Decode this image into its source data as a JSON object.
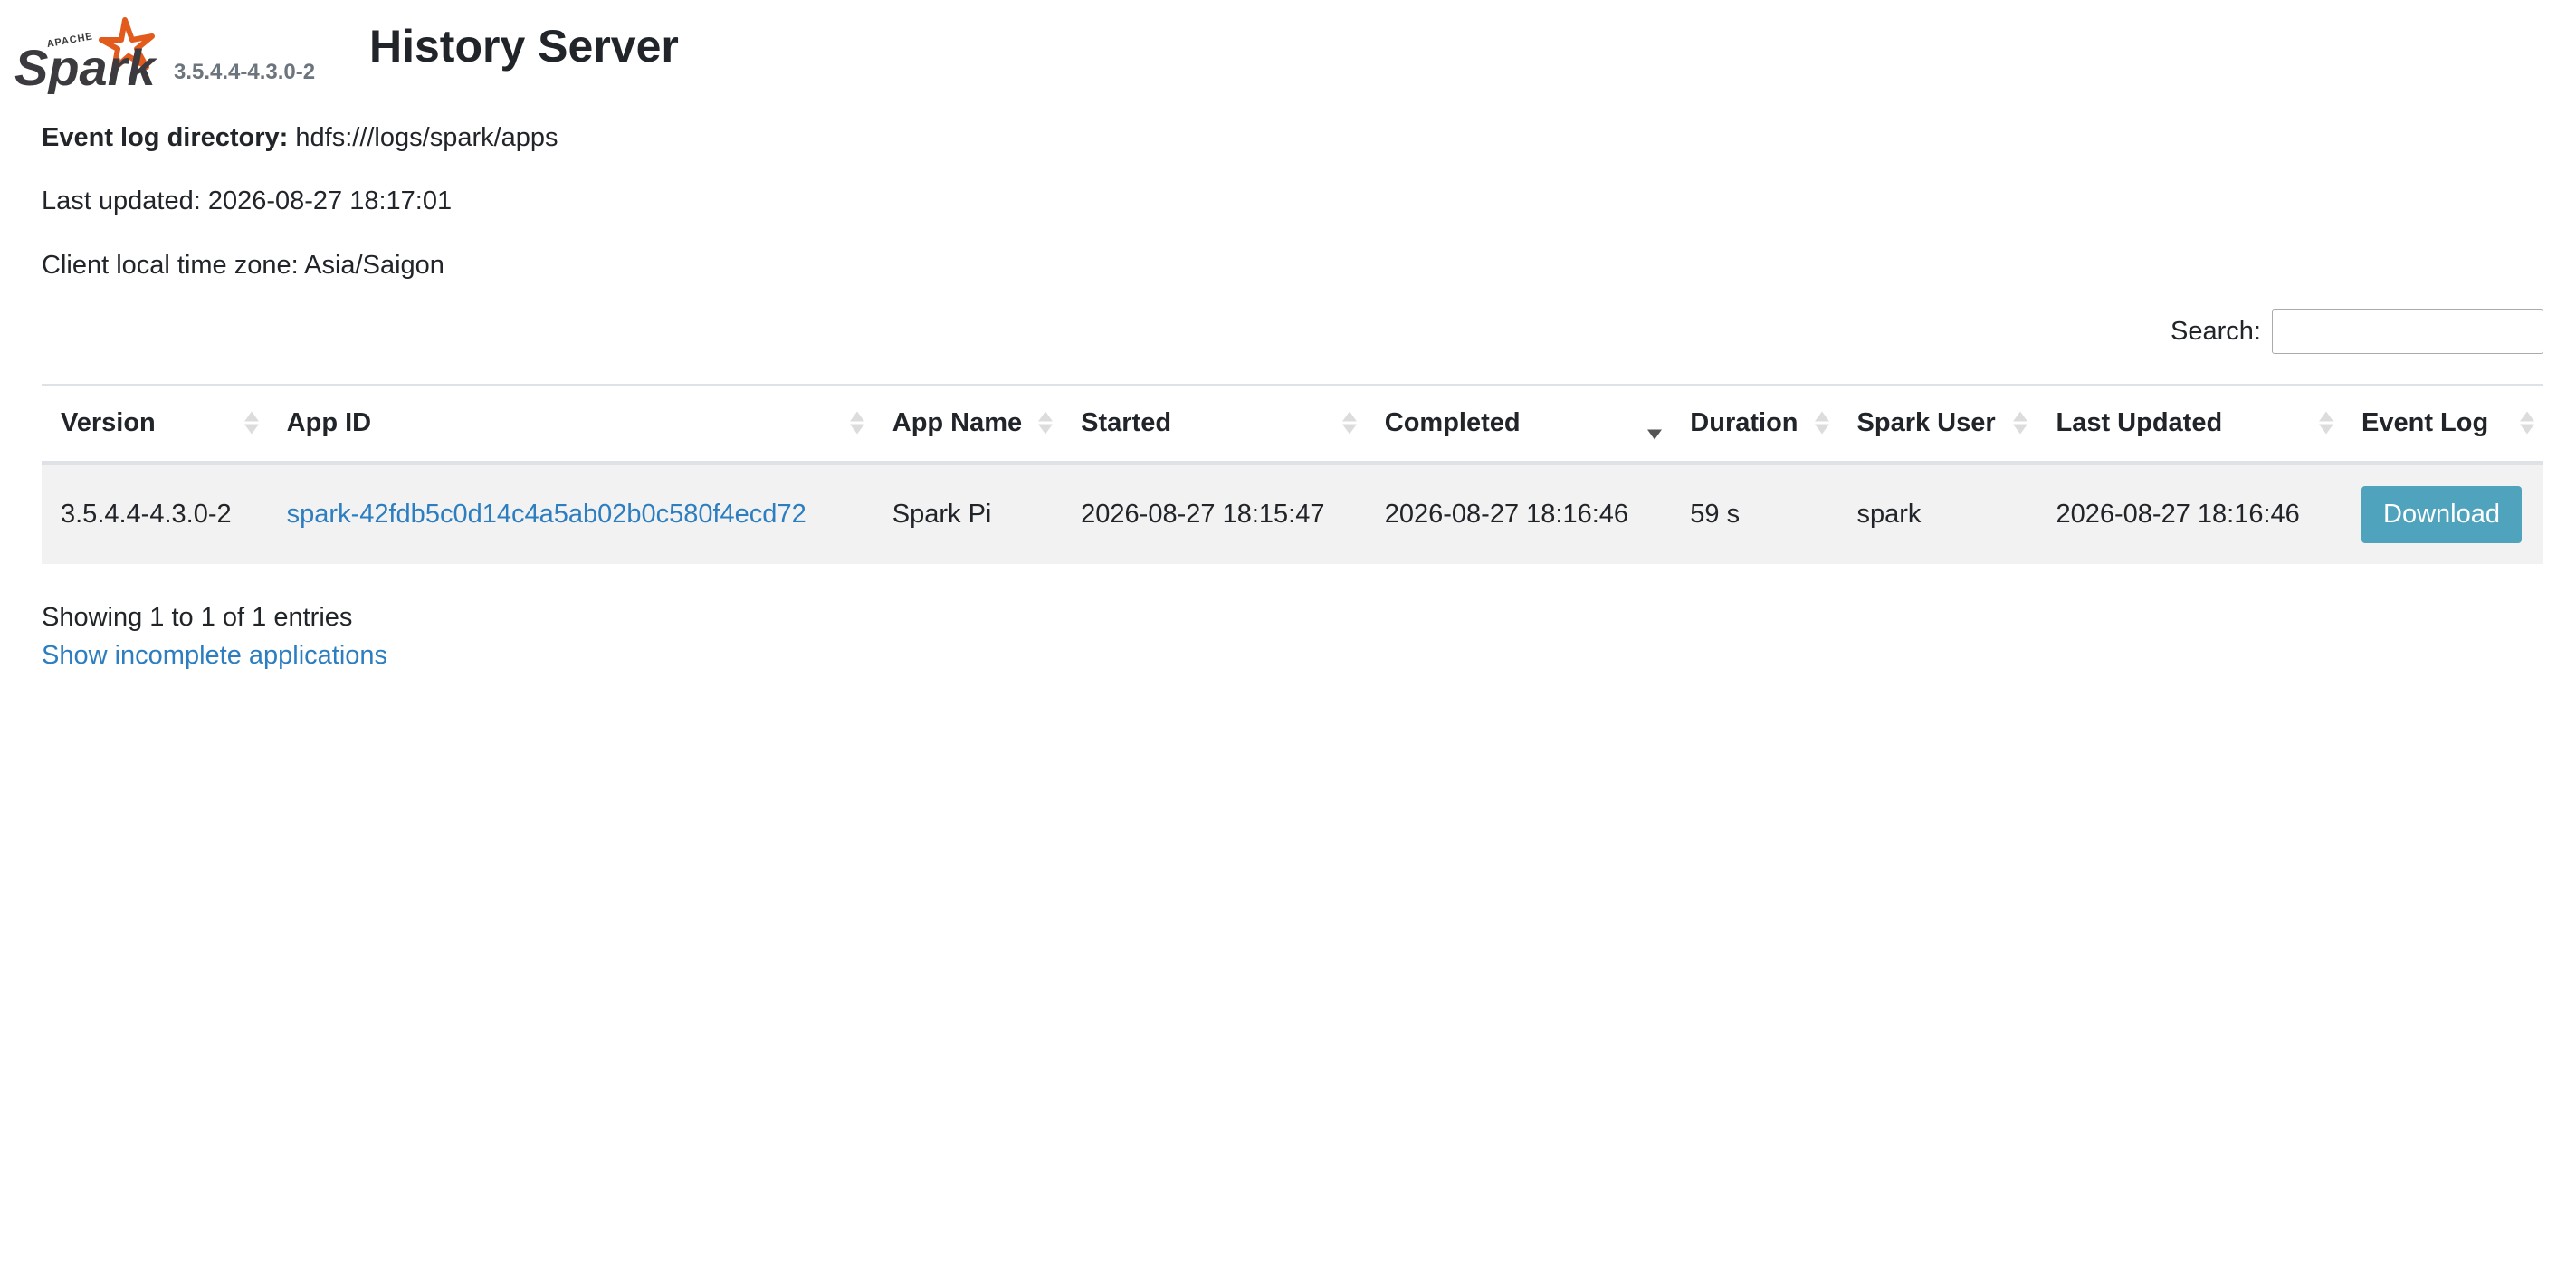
{
  "header": {
    "logo_icon": "apache-spark-logo",
    "logo_text": "Spark",
    "logo_small": "APACHE",
    "version": "3.5.4.4-4.3.0-2",
    "title": "History Server"
  },
  "info": {
    "event_log_label": "Event log directory:",
    "event_log_value": "hdfs:///logs/spark/apps",
    "last_updated": "Last updated: 2026-08-27 18:17:01",
    "time_zone": "Client local time zone: Asia/Saigon"
  },
  "search": {
    "label": "Search:",
    "value": ""
  },
  "table": {
    "columns": [
      "Version",
      "App ID",
      "App Name",
      "Started",
      "Completed",
      "Duration",
      "Spark User",
      "Last Updated",
      "Event Log"
    ],
    "sorted_column": "Completed",
    "sort_direction": "desc",
    "rows": [
      {
        "version": "3.5.4.4-4.3.0-2",
        "app_id": "spark-42fdb5c0d14c4a5ab02b0c580f4ecd72",
        "app_name": "Spark Pi",
        "started": "2026-08-27 18:15:47",
        "completed": "2026-08-27 18:16:46",
        "duration": "59 s",
        "spark_user": "spark",
        "last_updated": "2026-08-27 18:16:46",
        "event_log": "Download"
      }
    ]
  },
  "footer": {
    "showing": "Showing 1 to 1 of 1 entries",
    "incomplete_link": "Show incomplete applications"
  },
  "colors": {
    "link": "#2c7ec0",
    "button": "#4fa3bd",
    "row_bg": "#f2f2f2",
    "logo_orange": "#e25a1c",
    "logo_dark": "#3c3a3e"
  }
}
